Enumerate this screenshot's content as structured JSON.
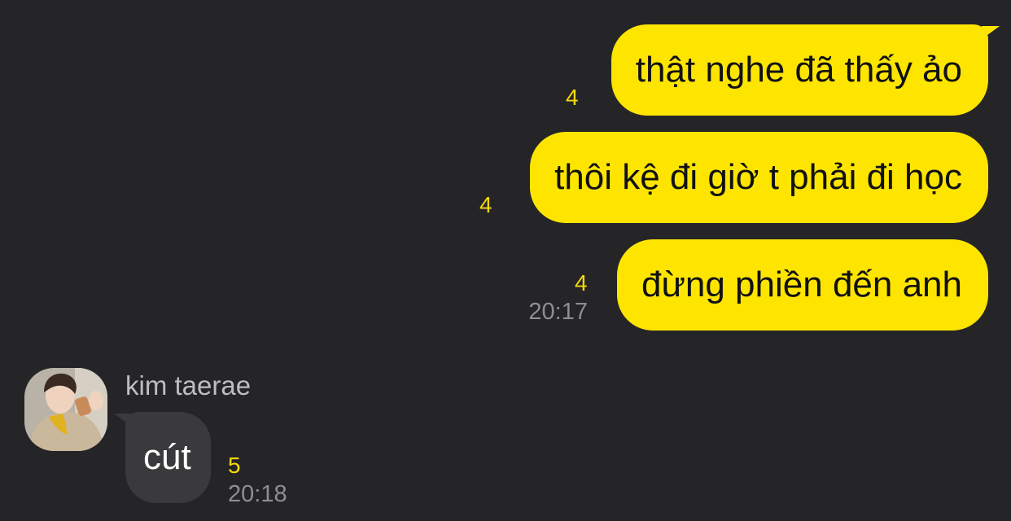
{
  "messages": [
    {
      "text": "thật nghe đã thấy ảo",
      "unread": "4"
    },
    {
      "text": "thôi kệ đi giờ t phải đi học",
      "unread": "4"
    },
    {
      "text": "đừng phiền đến anh",
      "unread": "4",
      "time": "20:17"
    }
  ],
  "incoming": {
    "sender": "kim taerae",
    "text": "cút",
    "unread": "5",
    "time": "20:18"
  },
  "colors": {
    "background": "#252527",
    "outgoing_bubble": "#FEE500",
    "incoming_bubble": "#3A3A3D",
    "unread_count": "#F5D90A",
    "timestamp": "#8E8E93"
  }
}
